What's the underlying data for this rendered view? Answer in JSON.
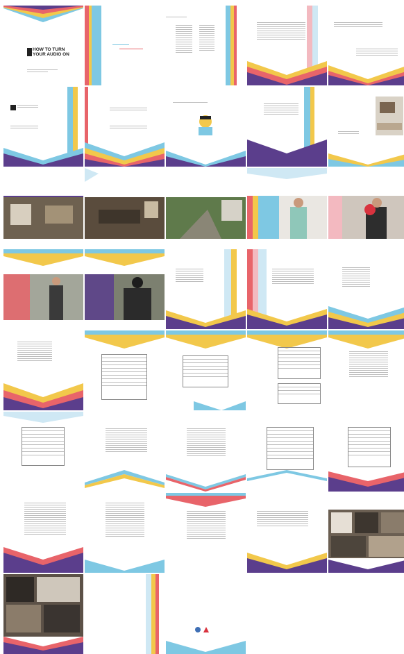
{
  "cover": {
    "title_line1": "HOW TO TURN",
    "title_line2": "YOUR AUDIO ON"
  },
  "colors": {
    "purple": "#5b3e8c",
    "coral": "#e8646a",
    "yellow": "#f2c84b",
    "sky": "#7ec8e3",
    "pale_blue": "#cfe8f4",
    "pink": "#f3b9c0"
  },
  "icons": {
    "cover": "audio-device-icon"
  }
}
